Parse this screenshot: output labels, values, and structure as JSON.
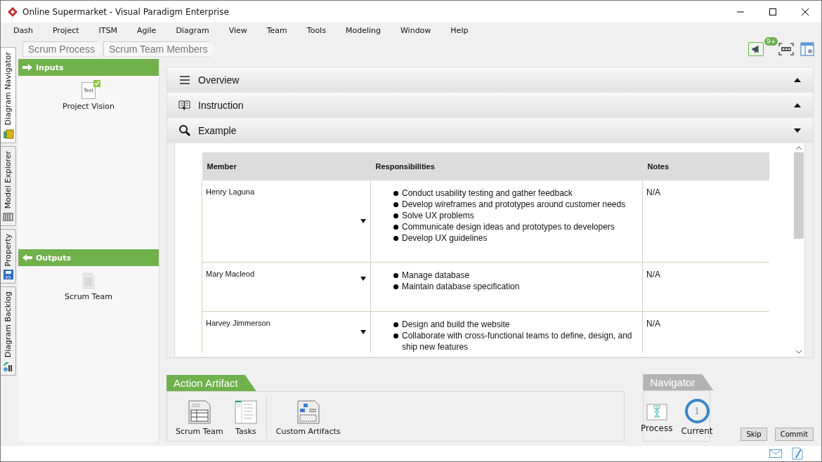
{
  "window": {
    "title": "Online Supermarket - Visual Paradigm Enterprise"
  },
  "menu": [
    "Dash",
    "Project",
    "ITSM",
    "Agile",
    "Diagram",
    "View",
    "Team",
    "Tools",
    "Modeling",
    "Window",
    "Help"
  ],
  "side_tabs": [
    {
      "label": "Diagram Navigator",
      "kind": "navigator",
      "selected": true
    },
    {
      "label": "Model Explorer",
      "kind": "explorer",
      "selected": false
    },
    {
      "label": "Property",
      "kind": "property",
      "selected": false
    },
    {
      "label": "Diagram Backlog",
      "kind": "backlog",
      "selected": false
    }
  ],
  "breadcrumb": [
    "Scrum Process",
    "Scrum Team Members"
  ],
  "toolbar": {
    "notification_badge": "9+"
  },
  "inputs": {
    "title": "Inputs",
    "items": [
      {
        "label": "Project Vision",
        "icon_text": "Text",
        "checked": true
      }
    ]
  },
  "outputs": {
    "title": "Outputs",
    "items": [
      {
        "label": "Scrum Team",
        "checked": false
      }
    ]
  },
  "sections": [
    {
      "title": "Overview",
      "kind": "overview",
      "expanded": false
    },
    {
      "title": "Instruction",
      "kind": "instruction",
      "expanded": false
    },
    {
      "title": "Example",
      "kind": "example",
      "expanded": true
    }
  ],
  "example_table": {
    "columns": [
      "Member",
      "Responsibilities",
      "Notes"
    ],
    "rows": [
      {
        "member": "Henry Laguna",
        "responsibilities": [
          "Conduct usability testing and gather feedback",
          "Develop wireframes and prototypes around customer needs",
          "Solve UX problems",
          "Communicate design ideas and prototypes to developers",
          "Develop UX guidelines"
        ],
        "notes": "N/A"
      },
      {
        "member": "Mary Macleod",
        "responsibilities": [
          "Manage database",
          "Maintain database specification"
        ],
        "notes": "N/A"
      },
      {
        "member": "Harvey Jimmerson",
        "responsibilities": [
          "Design and build the website",
          "Collaborate with cross-functional teams to define, design, and ship new features"
        ],
        "notes": "N/A"
      }
    ]
  },
  "action_artifact": {
    "title": "Action Artifact",
    "items": [
      {
        "label": "Scrum Team",
        "kind": "table"
      },
      {
        "label": "Tasks",
        "kind": "tasks"
      },
      {
        "label": "Custom Artifacts",
        "kind": "custom"
      }
    ]
  },
  "navigator": {
    "title": "Navigator",
    "items": [
      {
        "label": "Process",
        "kind": "process"
      },
      {
        "label": "Current",
        "kind": "current",
        "number": "1"
      }
    ]
  },
  "buttons": [
    "Skip",
    "Commit"
  ]
}
